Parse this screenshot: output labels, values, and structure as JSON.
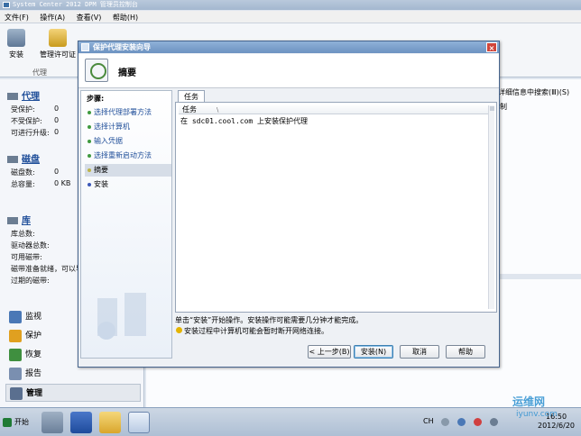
{
  "app": {
    "title": "System Center 2012 DPM 管理员控制台"
  },
  "menu": {
    "items": [
      "文件(F)",
      "操作(A)",
      "查看(V)",
      "帮助(H)"
    ]
  },
  "ribbon": {
    "install_label": "安装",
    "license_label": "管理许可证",
    "group_label": "代理"
  },
  "right_pane": {
    "search_hint": "详细信息中搜索(Ⅲ)(S)",
    "column_hint": "制"
  },
  "nav": {
    "agents": {
      "title": "代理",
      "rows": [
        {
          "label": "受保护:",
          "value": "0"
        },
        {
          "label": "不受保护:",
          "value": "0"
        },
        {
          "label": "可进行升级:",
          "value": "0"
        }
      ]
    },
    "disks": {
      "title": "磁盘",
      "rows": [
        {
          "label": "磁盘数:",
          "value": "0"
        },
        {
          "label": "总容量:",
          "value": "0 KB"
        }
      ]
    },
    "library": {
      "title": "库",
      "rows": [
        "库总数:",
        "驱动器总数:",
        "可用磁带:",
        "磁带准备就绪，可以导",
        "过期的磁带:"
      ]
    },
    "buttons": [
      {
        "label": "监视",
        "color": "#4a78b6"
      },
      {
        "label": "保护",
        "color": "#e0a020"
      },
      {
        "label": "恢复",
        "color": "#3f8f3f"
      },
      {
        "label": "报告",
        "color": "#7a8fb0"
      },
      {
        "label": "管理",
        "color": "#5a6f8f"
      }
    ],
    "selected": "管理"
  },
  "wizard": {
    "title": "保护代理安装向导",
    "close": "×",
    "heading": "摘要",
    "steps_title": "步骤:",
    "steps": [
      {
        "label": "选择代理部署方法",
        "state": "done"
      },
      {
        "label": "选择计算机",
        "state": "done"
      },
      {
        "label": "输入凭据",
        "state": "done"
      },
      {
        "label": "选择重新启动方法",
        "state": "done"
      },
      {
        "label": "摘要",
        "state": "current"
      },
      {
        "label": "安装",
        "state": "todo"
      }
    ],
    "tab_label": "任务",
    "table_header": "任务",
    "sort_glyph": "\\",
    "task_row": "在 sdc01.cool.com 上安装保护代理",
    "info_text": "单击“安装”开始操作。安装操作可能需要几分钟才能完成。",
    "warning_text": "安装过程中计算机可能会暂时断开网络连接。",
    "buttons": {
      "back": "< 上一步(B)",
      "install": "安装(N)",
      "cancel": "取消",
      "help": "帮助"
    }
  },
  "taskbar": {
    "start": "开始",
    "lang": "CH",
    "time": "16:50",
    "date": "2012/6/20",
    "watermark": "运维网",
    "watermark_url": "iyunv.com"
  }
}
